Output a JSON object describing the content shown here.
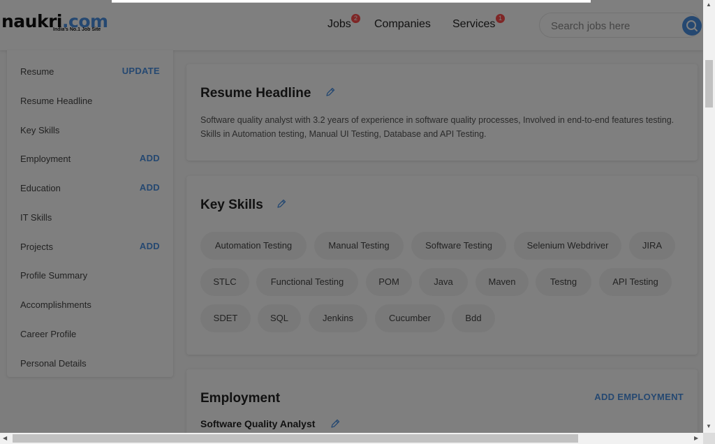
{
  "header": {
    "logo": {
      "name": "naukri",
      "tld": ".com",
      "tagline": "India's No.1 Job Site"
    },
    "nav": [
      {
        "label": "Jobs",
        "badge": "2"
      },
      {
        "label": "Companies"
      },
      {
        "label": "Services",
        "badge": "1"
      }
    ],
    "search": {
      "placeholder": "Search jobs here"
    }
  },
  "sidebar": {
    "items": [
      {
        "label": "Resume",
        "action": "UPDATE"
      },
      {
        "label": "Resume Headline"
      },
      {
        "label": "Key Skills"
      },
      {
        "label": "Employment",
        "action": "ADD"
      },
      {
        "label": "Education",
        "action": "ADD"
      },
      {
        "label": "IT Skills"
      },
      {
        "label": "Projects",
        "action": "ADD"
      },
      {
        "label": "Profile Summary"
      },
      {
        "label": "Accomplishments"
      },
      {
        "label": "Career Profile"
      },
      {
        "label": "Personal Details"
      }
    ]
  },
  "resume_headline": {
    "title": "Resume Headline",
    "text": "Software quality analyst with 3.2 years of experience in software quality processes, Involved in end-to-end features testing. Skills in Automation testing, Manual UI Testing, Database and API Testing."
  },
  "key_skills": {
    "title": "Key Skills",
    "skills": [
      "Automation Testing",
      "Manual Testing",
      "Software Testing",
      "Selenium Webdriver",
      "JIRA",
      "STLC",
      "Functional Testing",
      "POM",
      "Java",
      "Maven",
      "Testng",
      "API Testing",
      "SDET",
      "SQL",
      "Jenkins",
      "Cucumber",
      "Bdd"
    ]
  },
  "employment": {
    "title": "Employment",
    "add_label": "ADD EMPLOYMENT",
    "first_role": "Software Quality Analyst"
  },
  "colors": {
    "accent": "#4a90e2",
    "badge": "#ff4d4d",
    "overlay": "rgba(0,0,0,0.5)"
  }
}
